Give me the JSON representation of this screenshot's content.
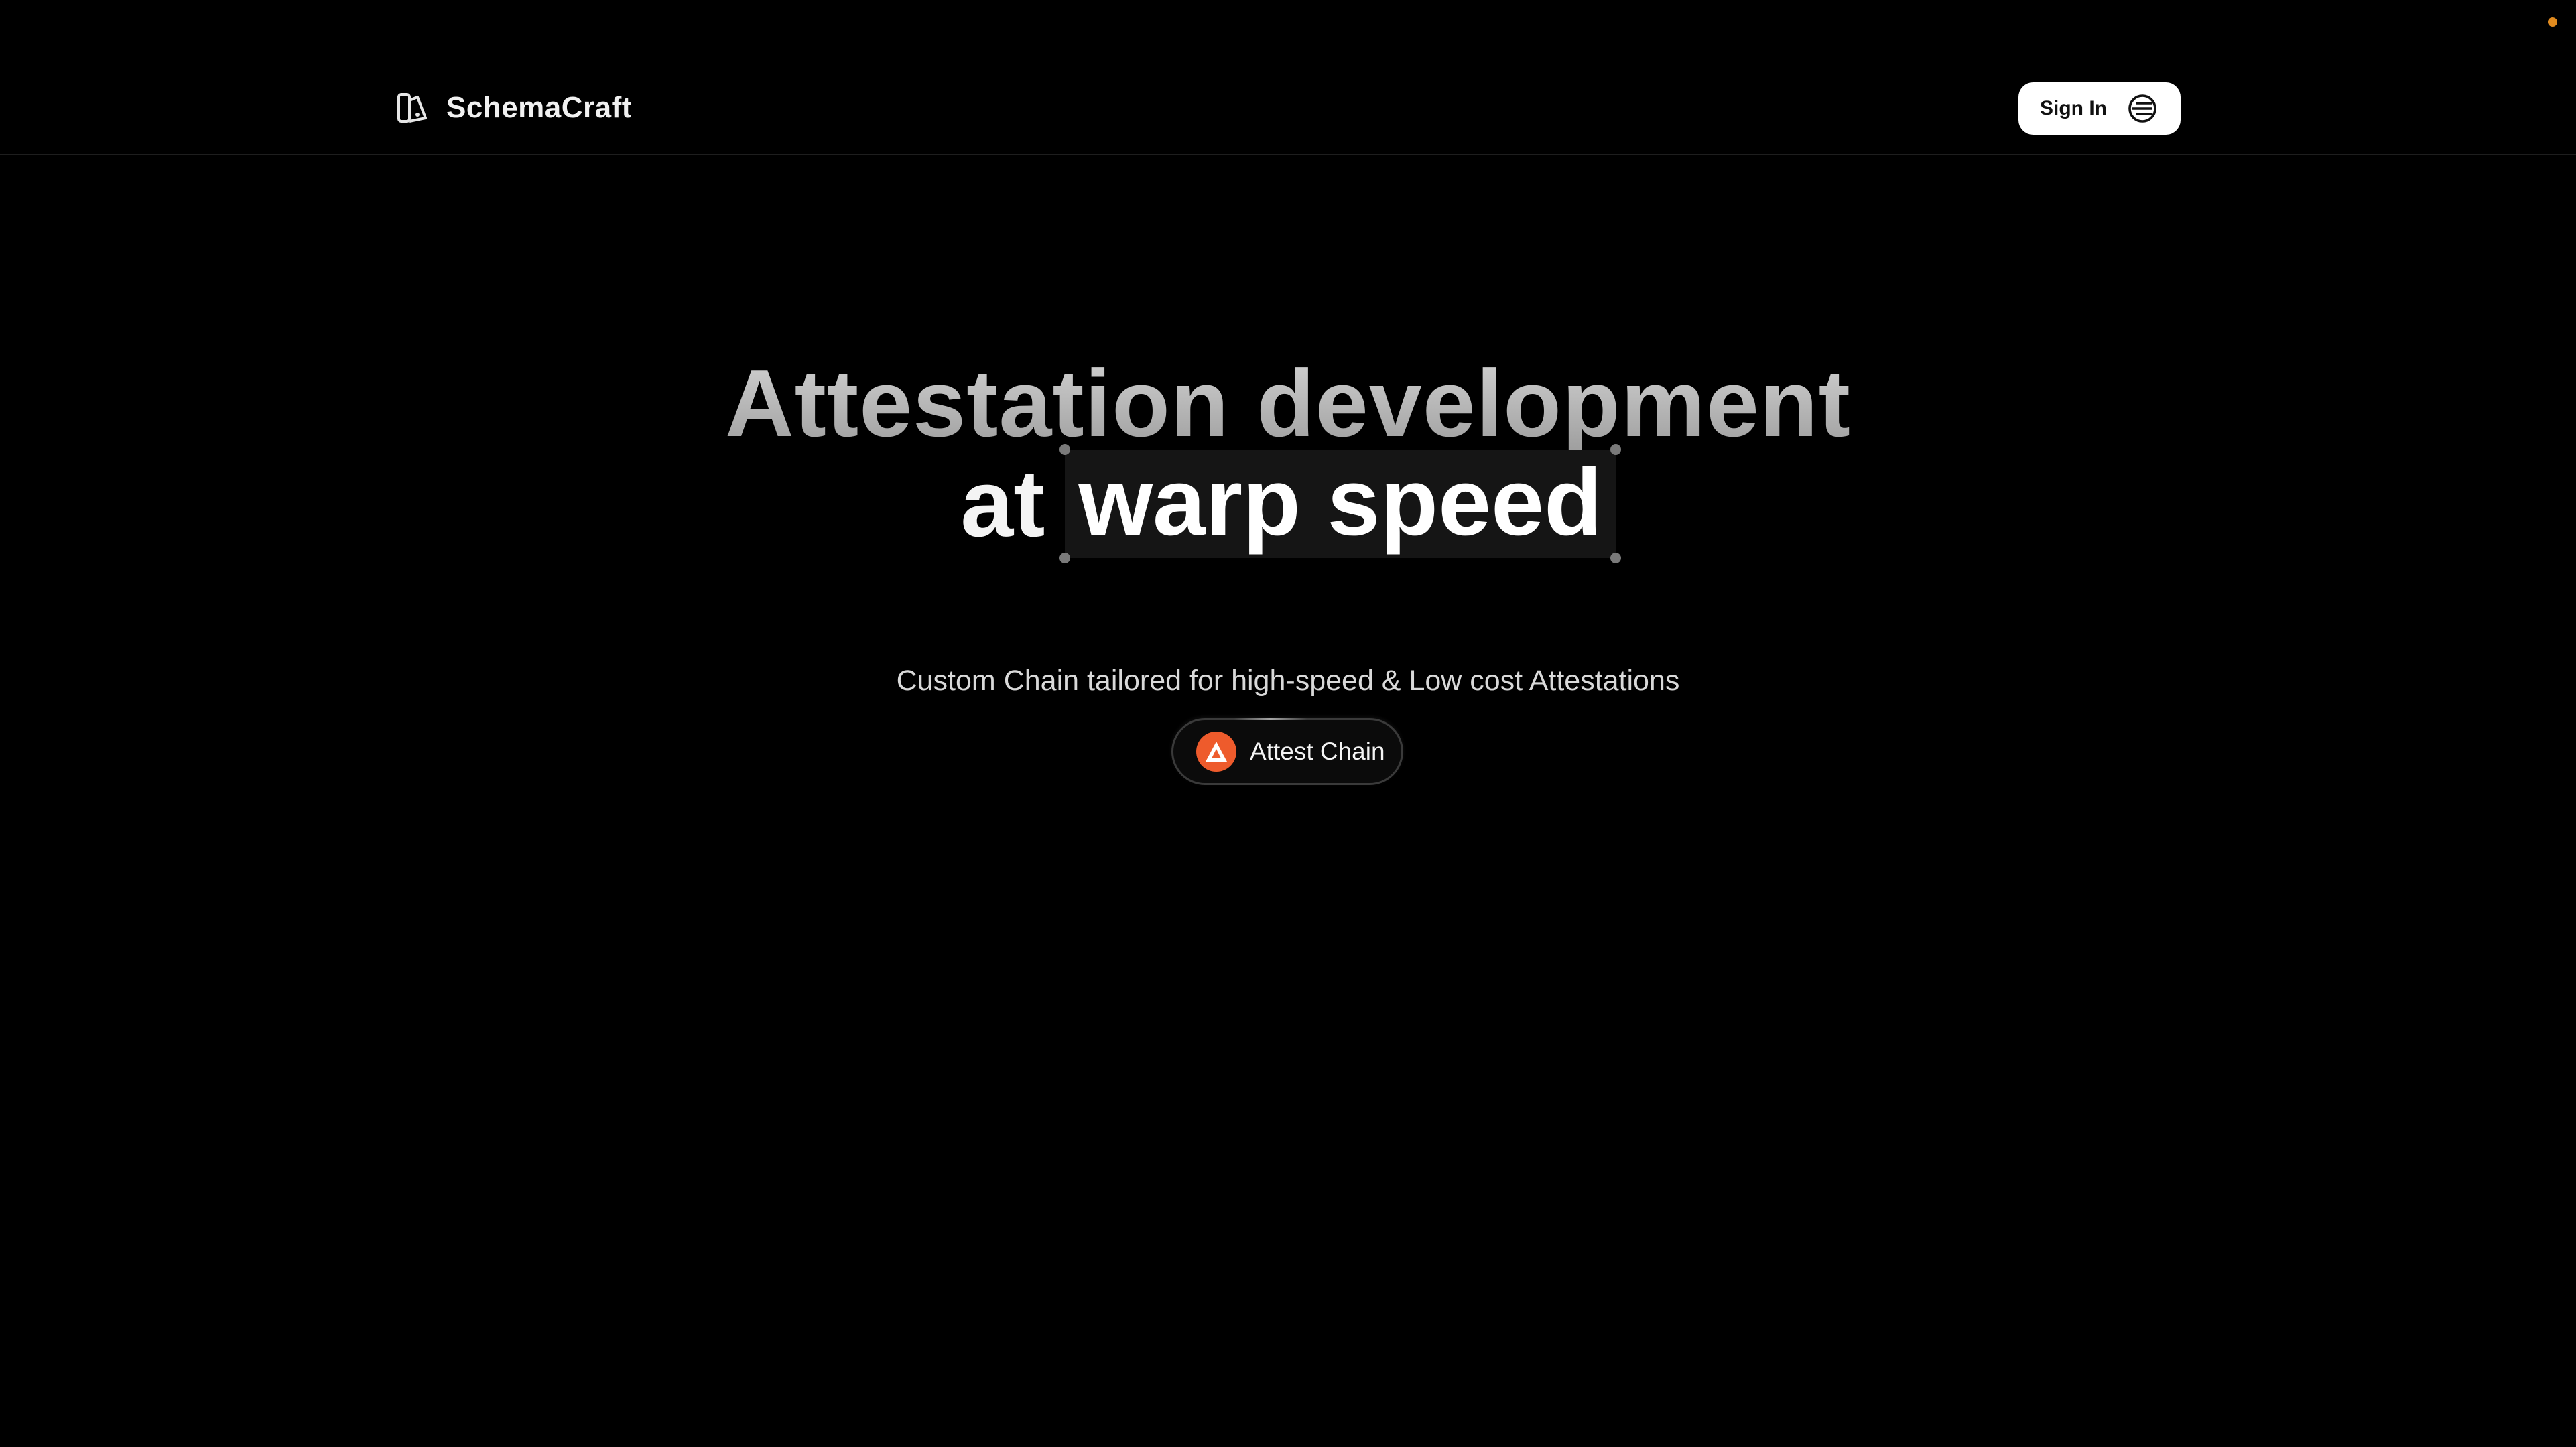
{
  "header": {
    "brand_name": "SchemaCraft",
    "brand_icon": "schema-logo-icon",
    "signin_label": "Sign In",
    "signin_icon": "wallet-connect-icon"
  },
  "hero": {
    "line1": "Attestation development",
    "line2_prefix": "at",
    "line2_highlight": "warp speed",
    "subtitle": "Custom Chain tailored for high-speed & Low cost Attestations"
  },
  "chain_pill": {
    "label": "Attest Chain",
    "icon": "attest-chain-icon"
  },
  "colors": {
    "background": "#000000",
    "accent_orange": "#ee5b2c",
    "status_dot": "#e08a1e"
  }
}
